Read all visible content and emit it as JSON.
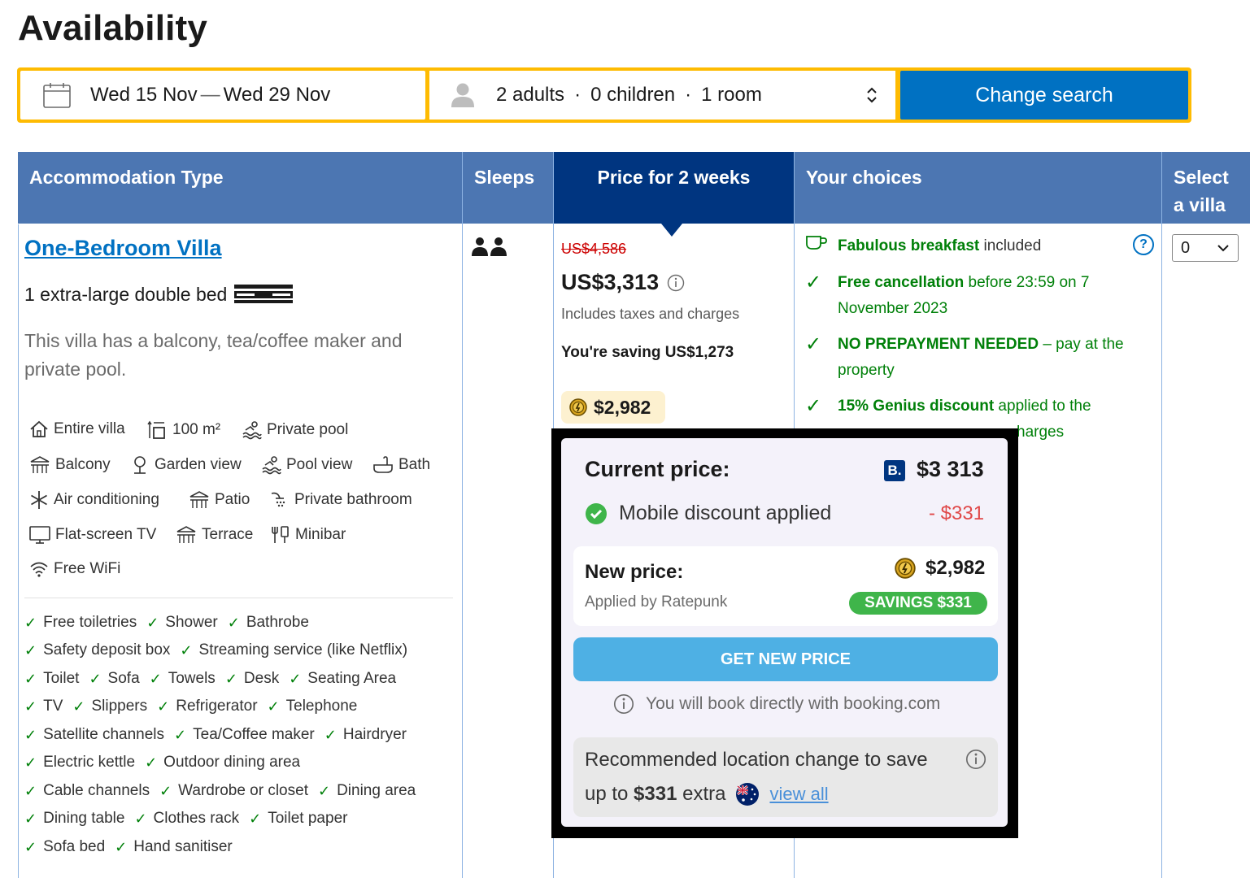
{
  "page": {
    "title": "Availability"
  },
  "search": {
    "date_from": "Wed 15 Nov",
    "date_sep": "—",
    "date_to": "Wed 29 Nov",
    "adults": "2 adults",
    "children": "0 children",
    "rooms": "1 room",
    "button_label": "Change search"
  },
  "table": {
    "headers": {
      "type": "Accommodation Type",
      "sleeps": "Sleeps",
      "price": "Price for 2 weeks",
      "choices": "Your choices",
      "select_line1": "Select",
      "select_line2": "a villa"
    },
    "room": {
      "name": "One-Bedroom Villa",
      "bed": "1 extra-large double bed",
      "description": "This villa has a balcony, tea/coffee maker and private pool.",
      "facilities": [
        "Entire villa",
        "100 m²",
        "Private pool",
        "Balcony",
        "Garden view",
        "Pool view",
        "Bath",
        "Air conditioning",
        "Patio",
        "Private bathroom",
        "Flat-screen TV",
        "Terrace",
        "Minibar",
        "Free WiFi"
      ],
      "amenity_rows": [
        [
          "Free toiletries",
          "Shower",
          "Bathrobe"
        ],
        [
          "Safety deposit box",
          "Streaming service (like Netflix)"
        ],
        [
          "Toilet",
          "Sofa",
          "Towels",
          "Desk",
          "Seating Area"
        ],
        [
          "TV",
          "Slippers",
          "Refrigerator",
          "Telephone"
        ],
        [
          "Satellite channels",
          "Tea/Coffee maker",
          "Hairdryer"
        ],
        [
          "Electric kettle",
          "Outdoor dining area"
        ],
        [
          "Cable channels",
          "Wardrobe or closet",
          "Dining area"
        ],
        [
          "Dining table",
          "Clothes rack",
          "Toilet paper"
        ],
        [
          "Sofa bed",
          "Hand sanitiser"
        ]
      ]
    },
    "price": {
      "original": "US$4,586",
      "current": "US$3,313",
      "taxes": "Includes taxes and charges",
      "saving": "You're saving US$1,273",
      "genius_price": "$2,982"
    },
    "choices": {
      "breakfast_bold": "Fabulous breakfast",
      "breakfast_rest": " included",
      "cancel_bold": "Free cancellation",
      "cancel_rest": " before 23:59 on 7 November 2023",
      "prepay_bold": "NO PREPAYMENT NEEDED",
      "prepay_rest": " – pay at the property",
      "genius_bold": "15% Genius discount",
      "genius_rest_line1": " applied to the",
      "genius_rest_line2": "harges",
      "help": "?"
    },
    "select": {
      "value": "0"
    }
  },
  "popup": {
    "current_label": "Current price:",
    "booking_logo": "B.",
    "current_value": "$3 313",
    "mobile_label": "Mobile discount applied",
    "mobile_discount": "- $331",
    "new_label": "New price:",
    "new_value": "$2,982",
    "applied_by": "Applied by Ratepunk",
    "savings_badge": "SAVINGS $331",
    "button": "GET NEW PRICE",
    "book_note": "You will book directly with booking.com",
    "rec_line1": "Recommended location change to save",
    "rec_prefix": "up to ",
    "rec_amount": "$331",
    "rec_suffix": " extra",
    "view_all": "view all"
  },
  "colors": {
    "brand_blue": "#003580",
    "header_blue": "#4c76b2",
    "accent_yellow": "#febb02",
    "button_blue": "#0071c2",
    "green": "#008009",
    "savings_green": "#3fb54a",
    "cta_blue": "#4eb0e4"
  }
}
